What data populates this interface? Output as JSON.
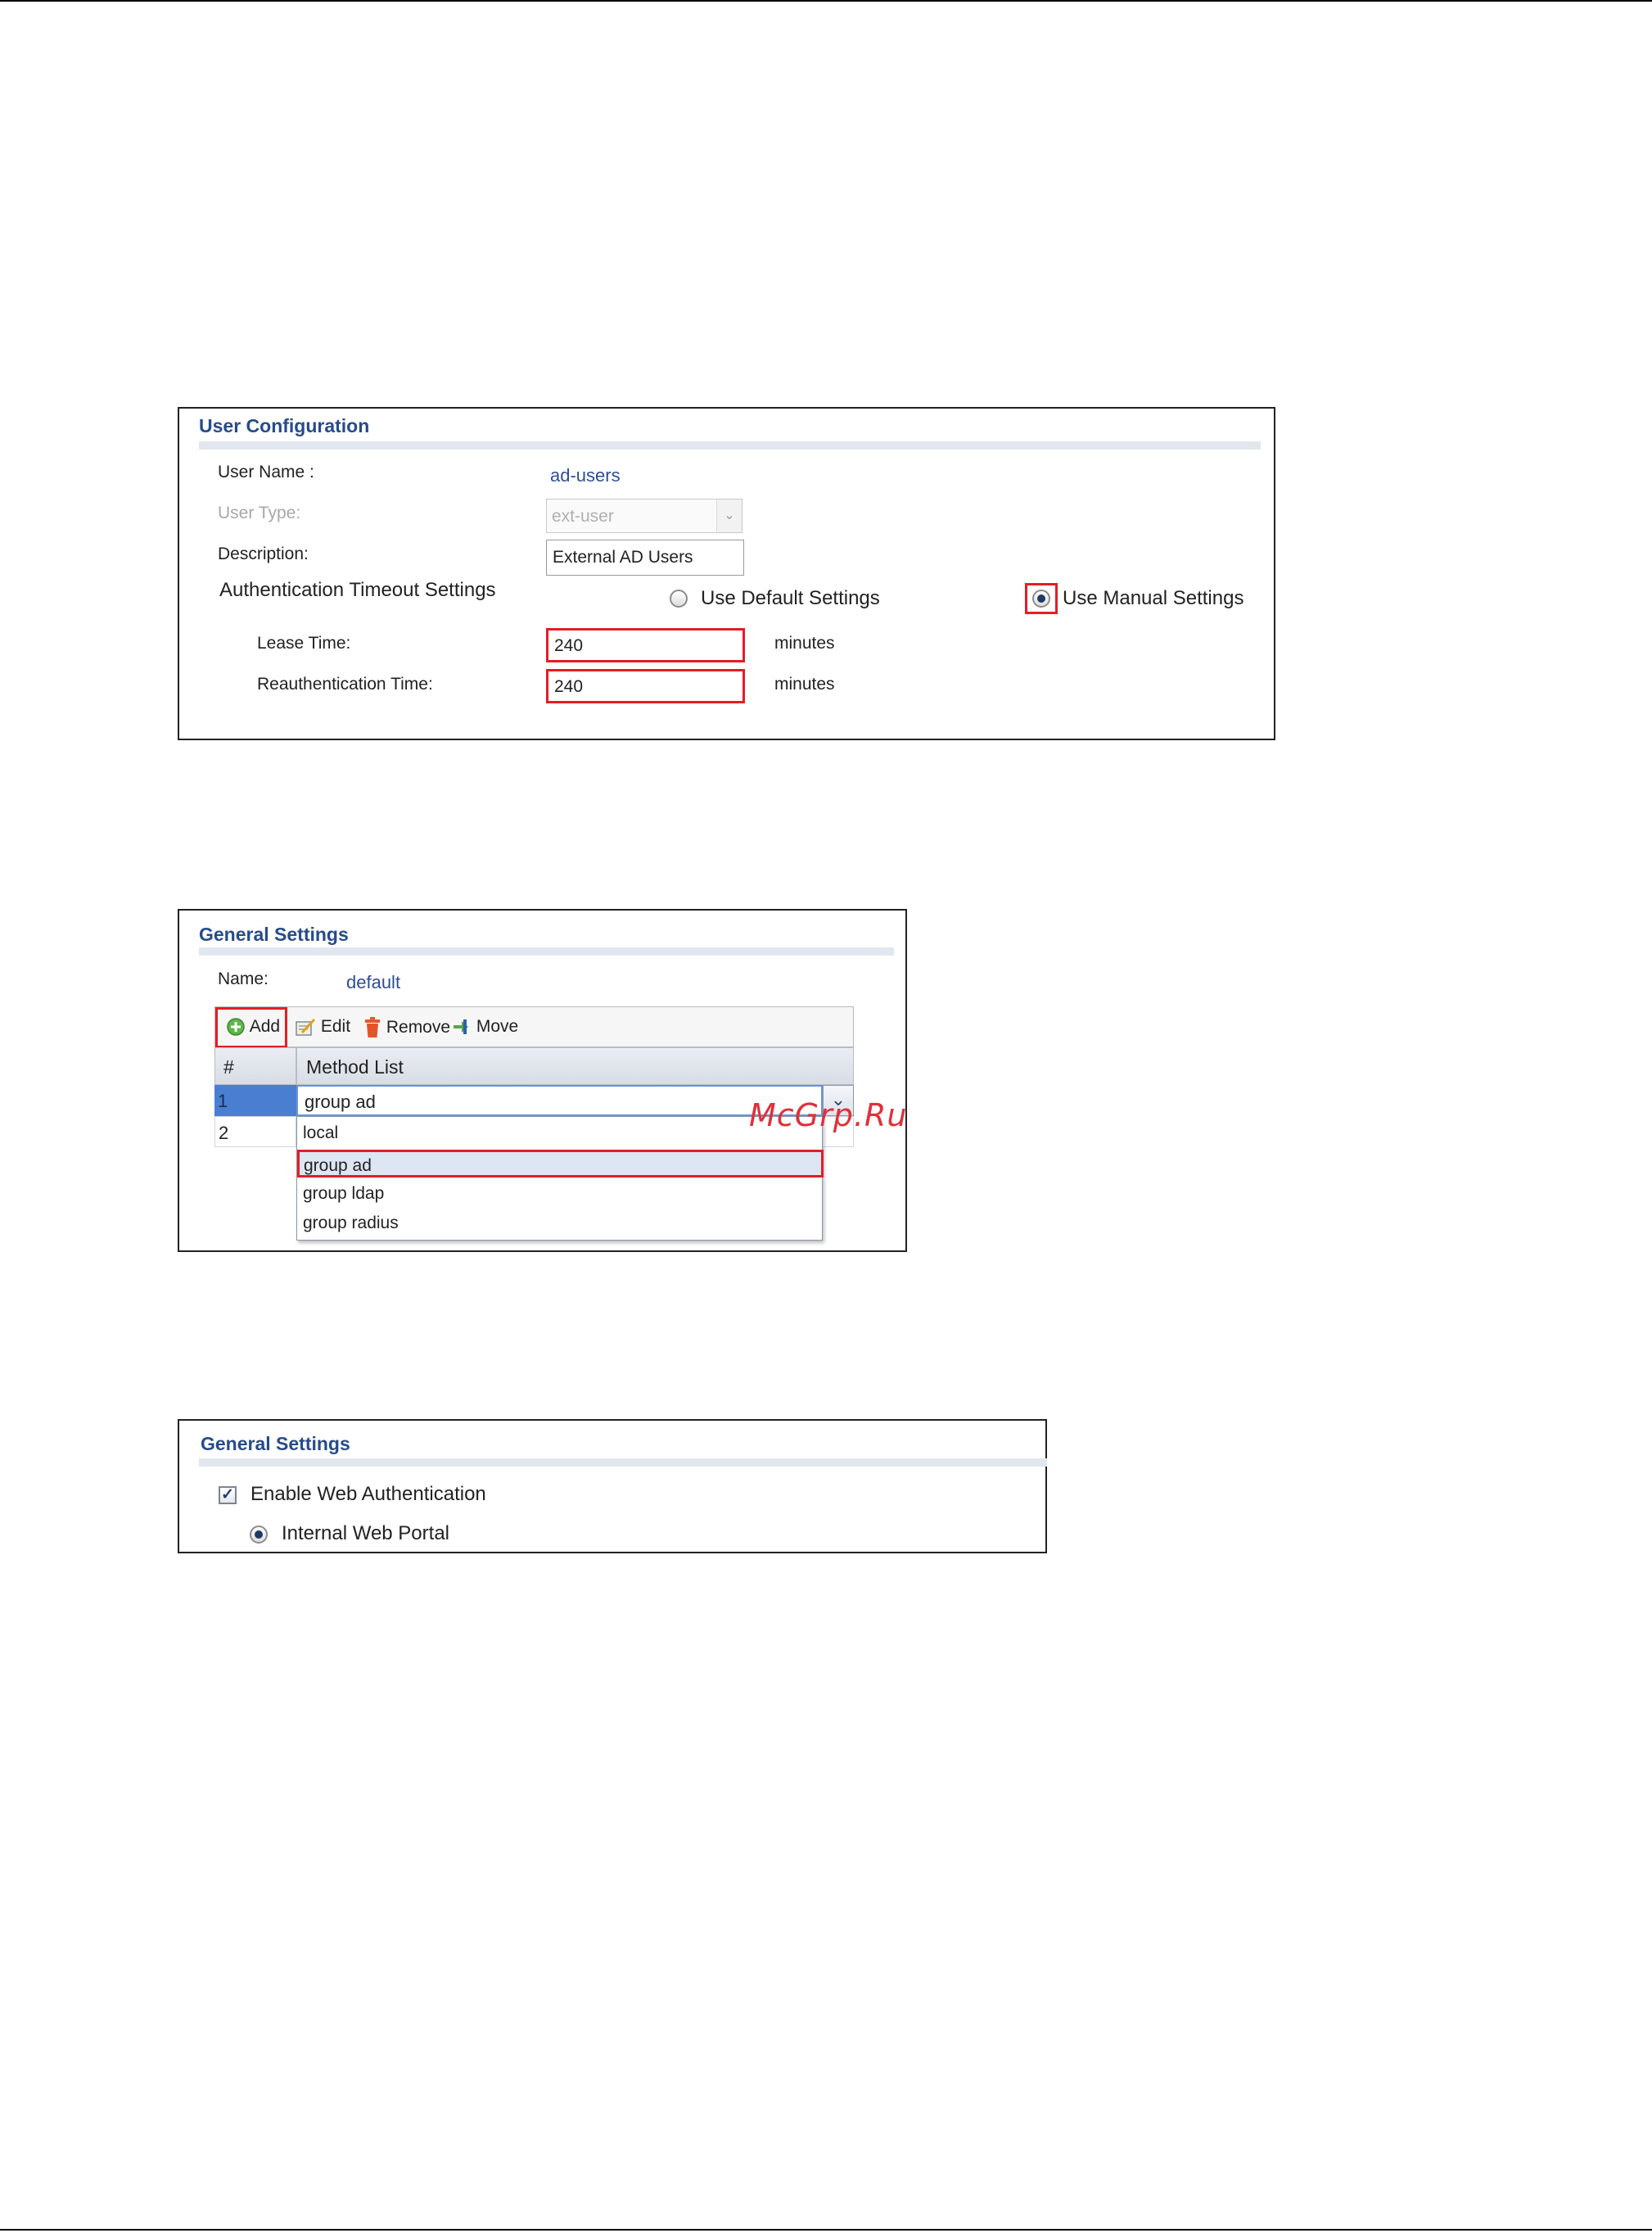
{
  "user_config": {
    "title": "User Configuration",
    "user_name_label": "User Name :",
    "user_name_value": "ad-users",
    "user_type_label": "User Type:",
    "user_type_value": "ext-user",
    "description_label": "Description:",
    "description_value": "External AD Users",
    "auth_timeout_label": "Authentication Timeout Settings",
    "use_default_label": "Use Default Settings",
    "use_manual_label": "Use Manual Settings",
    "selected_option": "Use Manual Settings",
    "lease_time_label": "Lease Time:",
    "lease_time_value": "240",
    "lease_time_unit": "minutes",
    "reauth_time_label": "Reauthentication Time:",
    "reauth_time_value": "240",
    "reauth_time_unit": "minutes"
  },
  "general_settings_methods": {
    "title": "General Settings",
    "name_label": "Name:",
    "name_value": "default",
    "toolbar": {
      "add": "Add",
      "edit": "Edit",
      "remove": "Remove",
      "move": "Move"
    },
    "columns": [
      "#",
      "Method List"
    ],
    "rows": [
      {
        "index": "1",
        "method": "group ad"
      },
      {
        "index": "2",
        "method": ""
      }
    ],
    "dropdown_options": [
      "local",
      "group ad",
      "group ldap",
      "group radius"
    ],
    "highlighted_option": "group ad"
  },
  "general_settings_web": {
    "title": "General Settings",
    "enable_web_auth_label": "Enable Web Authentication",
    "enable_web_auth_checked": true,
    "internal_portal_label": "Internal Web Portal",
    "internal_portal_selected": true
  },
  "watermark": "McGrp.Ru",
  "colors": {
    "title_blue": "#274b8b",
    "highlight_red": "#e31e24",
    "selected_row": "#4a7ed1",
    "dropdown_hover": "#dde6f3"
  },
  "icons": {
    "add": "green-plus-circle-icon",
    "edit": "pencil-note-icon",
    "remove": "trash-can-icon",
    "move": "move-arrow-icon",
    "dropdown": "chevron-down-icon"
  }
}
